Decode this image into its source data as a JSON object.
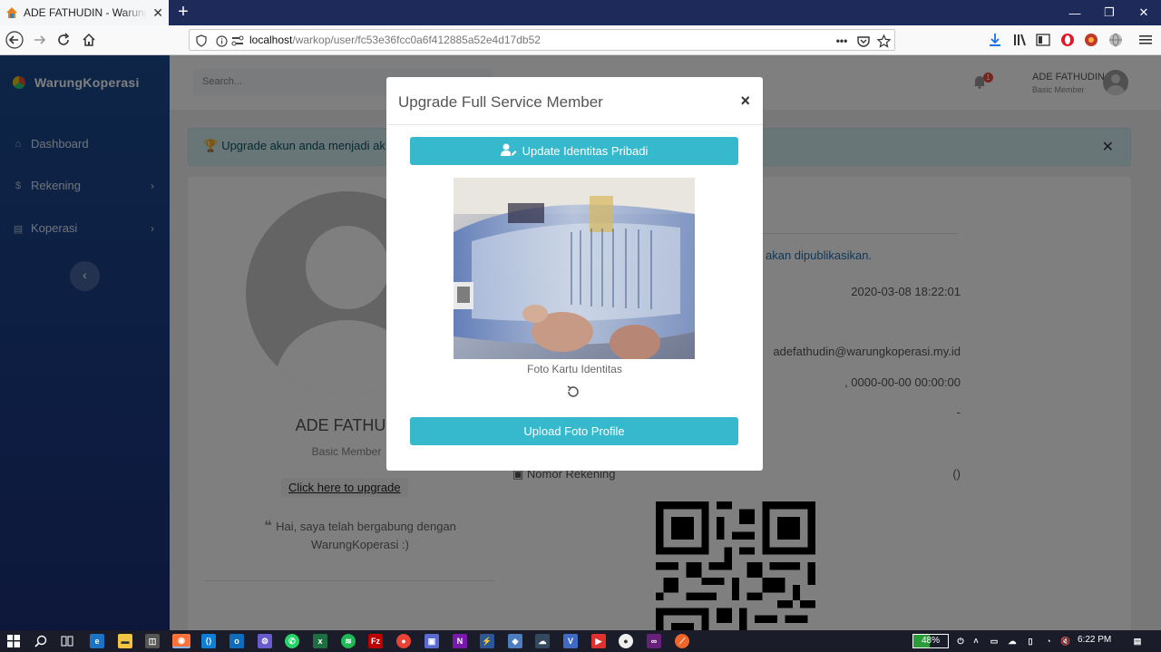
{
  "browser": {
    "tab_title": "ADE FATHUDIN - WarungKoperasi",
    "url_host": "localhost",
    "url_path": "/warkop/user/fc53e36fcc0a6f412885a52e4d17db52"
  },
  "sidebar": {
    "brand": "WarungKoperasi",
    "items": [
      {
        "label": "Dashboard",
        "icon": "home-icon"
      },
      {
        "label": "Rekening",
        "icon": "dollar-icon"
      },
      {
        "label": "Koperasi",
        "icon": "book-icon"
      }
    ]
  },
  "topbar": {
    "search_placeholder": "Search...",
    "notification_count": "1",
    "user_name": "ADE FATHUDIN",
    "user_role": "Basic Member"
  },
  "alert": {
    "text": "Upgrade akun anda menjadi ak"
  },
  "profile": {
    "name": "ADE FATHUD",
    "role": "Basic Member",
    "upgrade_link": "Click here to upgrade",
    "quote": "Hai, saya telah bergabung dengan WarungKoperasi :)",
    "publish_note": "akan dipublikasikan.",
    "joined": "2020-03-08 18:22:01",
    "email": "adefathudin@warungkoperasi.my.id",
    "last_login": ", 0000-00-00 00:00:00",
    "dash": "-",
    "account_label": "Nomor Rekening",
    "account_value": "()"
  },
  "modal": {
    "title": "Upgrade Full Service Member",
    "update_button": "Update Identitas Pribadi",
    "photo_caption": "Foto Kartu Identitas",
    "upload_button": "Upload Foto Profile"
  },
  "taskbar": {
    "battery": "48%",
    "time": "6:22 PM"
  },
  "colors": {
    "accent": "#36b9cc",
    "sidebar": "#1b3f88",
    "tabbar": "#1e2a5a"
  }
}
